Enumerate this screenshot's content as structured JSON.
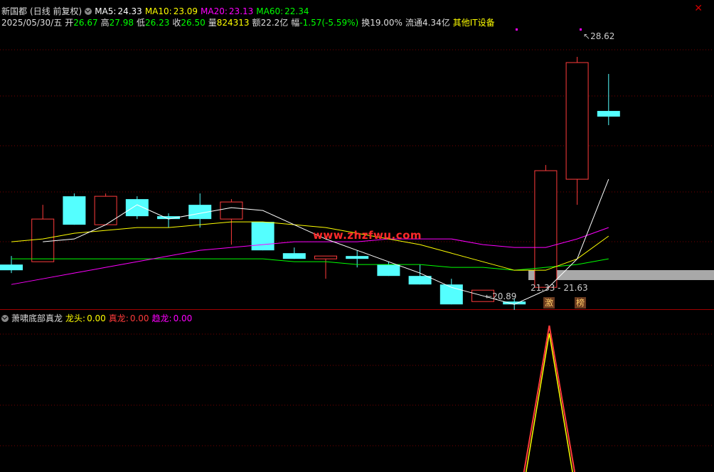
{
  "header": {
    "stock_name": "新国都",
    "period": "(日线 前复权)",
    "ma5_label": "MA5:",
    "ma5_value": "24.33",
    "ma10_label": "MA10:",
    "ma10_value": "23.09",
    "ma20_label": "MA20:",
    "ma20_value": "23.13",
    "ma60_label": "MA60:",
    "ma60_value": "22.34",
    "date": "2025/05/30/五",
    "open_label": "开",
    "open_value": "26.67",
    "high_label": "高",
    "high_value": "27.98",
    "low_label": "低",
    "low_value": "26.23",
    "close_label": "收",
    "close_value": "26.50",
    "volume_label": "量",
    "volume_value": "824313",
    "amount_label": "额",
    "amount_value": "22.2亿",
    "change_label": "幅",
    "change_value": "-1.57(-5.59%)",
    "turnover_label": "换",
    "turnover_value": "19.00%",
    "float_label": "流通",
    "float_value": "4.34亿",
    "sector": "其他IT设备"
  },
  "indicator": {
    "name": "萧啸底部真龙",
    "longtou_label": "龙头:",
    "longtou_value": "0.00",
    "zhenlong_label": "真龙:",
    "zhenlong_value": "0.00",
    "qulong_label": "趋龙:",
    "qulong_value": "0.00"
  },
  "annotations": {
    "high_label": "28.62",
    "low_label": "20.89",
    "range_label": "21.33 - 21.63",
    "badge_1": "激",
    "badge_2": "榜"
  },
  "watermark": "www.zhzfwu.com",
  "colors": {
    "up": "#ff3b3b",
    "down": "#54ffff",
    "ma5": "#ffffff",
    "ma10": "#ffff00",
    "ma20": "#ff00ff",
    "ma60": "#00ff00",
    "grid": "#7a0000"
  },
  "chart_data": {
    "type": "candlestick",
    "price_range": [
      19.98,
      29.6
    ],
    "candles": [
      {
        "o": 21.3,
        "h": 21.6,
        "l": 21.0,
        "c": 21.1
      },
      {
        "o": 21.4,
        "h": 23.4,
        "l": 21.4,
        "c": 22.9
      },
      {
        "o": 23.7,
        "h": 23.8,
        "l": 22.7,
        "c": 22.7
      },
      {
        "o": 22.7,
        "h": 23.8,
        "l": 22.7,
        "c": 23.7
      },
      {
        "o": 23.6,
        "h": 23.7,
        "l": 22.9,
        "c": 23.0
      },
      {
        "o": 23.0,
        "h": 23.1,
        "l": 22.6,
        "c": 22.9
      },
      {
        "o": 23.4,
        "h": 23.8,
        "l": 22.6,
        "c": 22.9
      },
      {
        "o": 22.9,
        "h": 23.6,
        "l": 22.0,
        "c": 23.5
      },
      {
        "o": 22.8,
        "h": 22.8,
        "l": 21.8,
        "c": 21.8
      },
      {
        "o": 21.7,
        "h": 21.9,
        "l": 21.5,
        "c": 21.5
      },
      {
        "o": 21.5,
        "h": 21.5,
        "l": 20.8,
        "c": 21.6
      },
      {
        "o": 21.6,
        "h": 21.8,
        "l": 21.2,
        "c": 21.5
      },
      {
        "o": 21.3,
        "h": 21.4,
        "l": 20.9,
        "c": 20.9
      },
      {
        "o": 20.9,
        "h": 21.3,
        "l": 20.6,
        "c": 20.6
      },
      {
        "o": 20.6,
        "h": 20.8,
        "l": 19.9,
        "c": 19.9
      },
      {
        "o": 20.0,
        "h": 20.0,
        "l": 20.0,
        "c": 20.4
      },
      {
        "o": 20.0,
        "h": 20.1,
        "l": 19.6,
        "c": 19.9
      },
      {
        "o": 20.5,
        "h": 24.8,
        "l": 20.5,
        "c": 24.6
      },
      {
        "o": 24.3,
        "h": 28.6,
        "l": 23.4,
        "c": 28.4
      },
      {
        "o": 26.7,
        "h": 28.0,
        "l": 26.2,
        "c": 26.5
      }
    ],
    "ma5": [
      null,
      22.1,
      22.2,
      22.7,
      23.4,
      22.9,
      23.1,
      23.3,
      23.2,
      22.7,
      22.2,
      21.8,
      21.4,
      21.0,
      20.5,
      20.2,
      19.9,
      20.4,
      21.5,
      24.3
    ],
    "ma10": [
      22.1,
      22.2,
      22.4,
      22.5,
      22.6,
      22.6,
      22.7,
      22.8,
      22.8,
      22.7,
      22.6,
      22.4,
      22.2,
      22.0,
      21.7,
      21.4,
      21.1,
      21.1,
      21.5,
      22.3
    ],
    "ma20": [
      20.6,
      20.8,
      21.0,
      21.2,
      21.4,
      21.6,
      21.8,
      21.9,
      22.0,
      22.1,
      22.1,
      22.1,
      22.2,
      22.2,
      22.2,
      22.0,
      21.9,
      21.9,
      22.2,
      22.6
    ],
    "ma60": [
      21.5,
      21.5,
      21.5,
      21.5,
      21.5,
      21.5,
      21.5,
      21.5,
      21.5,
      21.4,
      21.4,
      21.3,
      21.3,
      21.3,
      21.2,
      21.2,
      21.1,
      21.2,
      21.3,
      21.5
    ],
    "indicator_peak_index": 17
  }
}
